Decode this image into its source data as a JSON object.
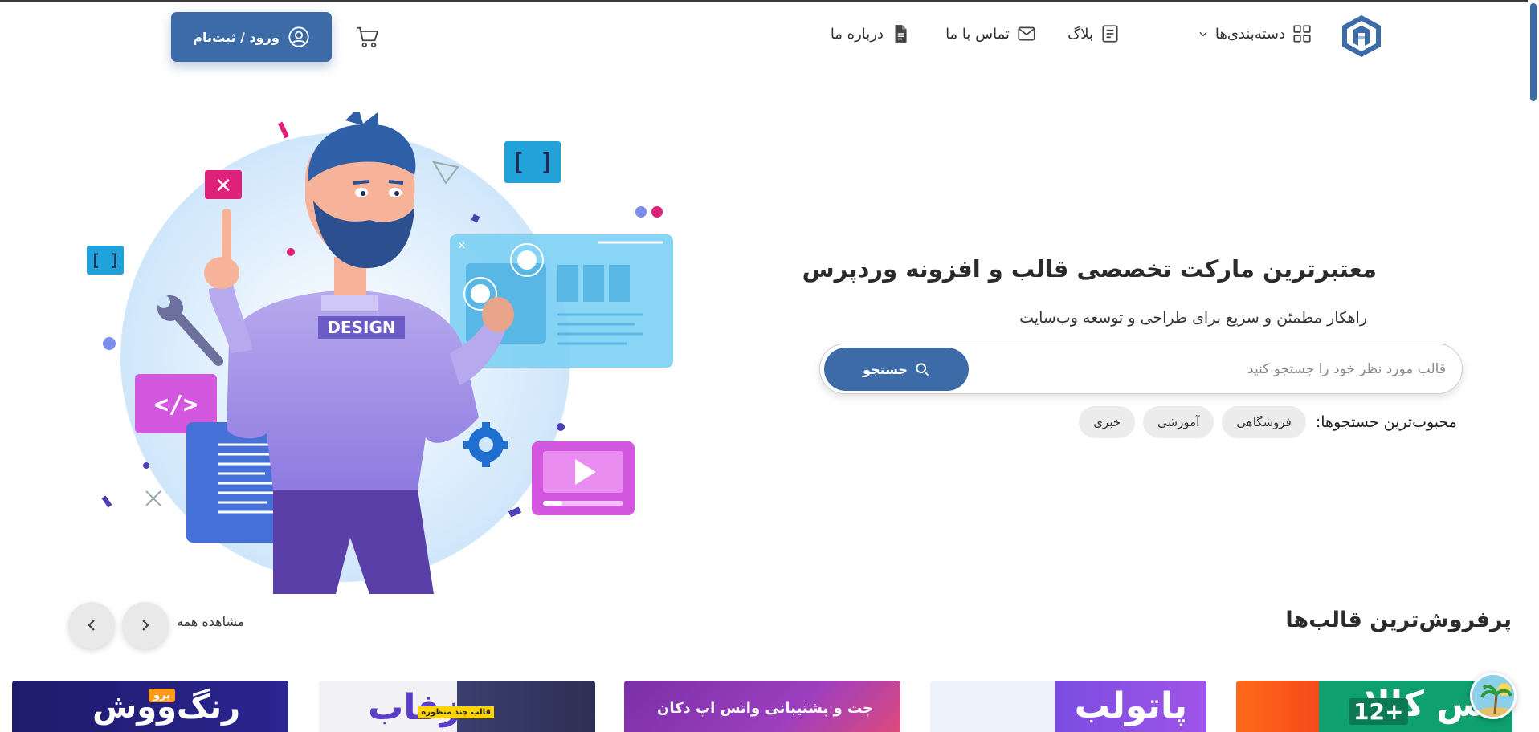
{
  "header": {
    "nav": {
      "categories": "دسته‌بندی‌ها",
      "blog": "بلاگ",
      "contact": "تماس با ما",
      "about": "درباره ما"
    },
    "login_label": "ورود / ثبت‌نام"
  },
  "hero": {
    "title": "معتبرترین مارکت تخصصی قالب و افزونه وردپرس",
    "subtitle": "راهکار مطمئن و سریع برای طراحی و توسعه وب‌سایت",
    "search": {
      "placeholder": "قالب مورد نظر خود را جستجو کنید",
      "button_label": "جستجو"
    },
    "popular": {
      "label": "محبوب‌ترین جستجوها:",
      "chips": [
        "فروشگاهی",
        "آموزشی",
        "خبری"
      ]
    },
    "illustration_text": "DESIGN"
  },
  "bestsellers": {
    "title": "پرفروش‌ترین قالب‌ها",
    "see_all": "مشاهده همه",
    "cards": [
      {
        "title": "س کالا",
        "badge": "+12"
      },
      {
        "title": "پاتولب"
      },
      {
        "title": "چت و پشتیبانی واتس اپ دکان"
      },
      {
        "title": "زفاب",
        "tag": "قالب چند منظوره"
      },
      {
        "title": "رنگ‌ووش",
        "badge": "پرو"
      }
    ]
  },
  "colors": {
    "primary": "#3d6ba7",
    "chip_bg": "#ececec",
    "text": "#2b2b2b"
  },
  "icons": [
    "logo-icon",
    "grid-icon",
    "chevron-down-icon",
    "document-icon",
    "mail-icon",
    "file-icon",
    "cart-icon",
    "user-circle-icon",
    "search-icon",
    "chevron-right-icon",
    "chevron-left-icon"
  ]
}
